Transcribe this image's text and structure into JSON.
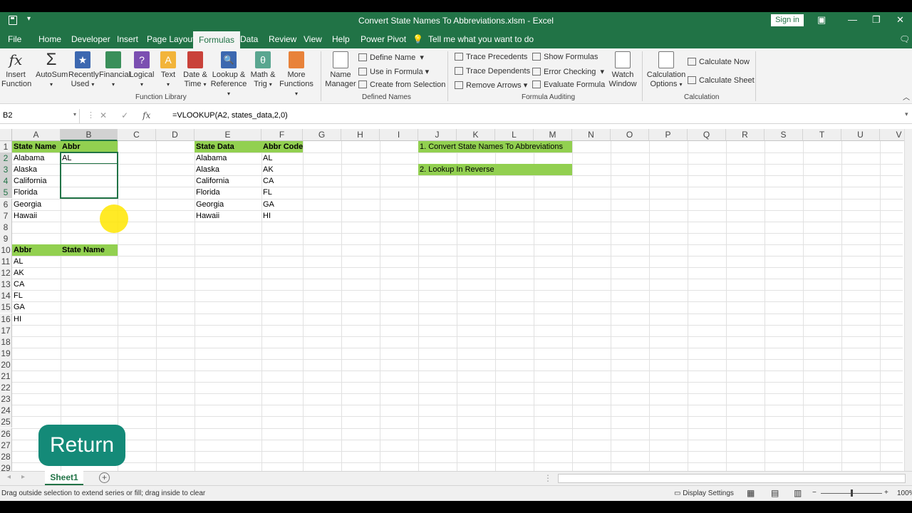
{
  "window": {
    "title": "Convert State Names To Abbreviations.xlsm  -  Excel",
    "signin": "Sign in"
  },
  "menu": {
    "tabs": [
      "File",
      "Home",
      "Developer",
      "Insert",
      "Page Layout",
      "Formulas",
      "Data",
      "Review",
      "View",
      "Help",
      "Power Pivot"
    ],
    "active": "Formulas",
    "tellme": "Tell me what you want to do"
  },
  "ribbon": {
    "insert_function": [
      "Insert",
      "Function"
    ],
    "autosum": "AutoSum",
    "recently_used": [
      "Recently",
      "Used"
    ],
    "financial": "Financial",
    "logical": "Logical",
    "text": "Text",
    "date_time": [
      "Date &",
      "Time"
    ],
    "lookup_ref": [
      "Lookup &",
      "Reference"
    ],
    "math_trig": [
      "Math &",
      "Trig"
    ],
    "more_functions": [
      "More",
      "Functions"
    ],
    "group_function_library": "Function Library",
    "name_manager": [
      "Name",
      "Manager"
    ],
    "define_name": "Define Name",
    "use_in_formula": "Use in Formula",
    "create_from_selection": "Create from Selection",
    "group_defined_names": "Defined Names",
    "trace_precedents": "Trace Precedents",
    "trace_dependents": "Trace Dependents",
    "remove_arrows": "Remove Arrows",
    "show_formulas": "Show Formulas",
    "error_checking": "Error Checking",
    "evaluate_formula": "Evaluate Formula",
    "group_formula_auditing": "Formula Auditing",
    "watch_window": [
      "Watch",
      "Window"
    ],
    "calc_options": [
      "Calculation",
      "Options"
    ],
    "calculate_now": "Calculate Now",
    "calculate_sheet": "Calculate Sheet",
    "group_calculation": "Calculation"
  },
  "formula_bar": {
    "name_box": "B2",
    "fx": "fx",
    "formula": "=VLOOKUP(A2, states_data,2,0)"
  },
  "columns": [
    "A",
    "B",
    "C",
    "D",
    "E",
    "F",
    "G",
    "H",
    "I",
    "J",
    "K",
    "L",
    "M",
    "N",
    "O",
    "P",
    "Q",
    "R",
    "S",
    "T",
    "U",
    "V"
  ],
  "rows": [
    "1",
    "2",
    "3",
    "4",
    "5",
    "6",
    "7",
    "8",
    "9",
    "10",
    "11",
    "12",
    "13",
    "14",
    "15",
    "16",
    "17",
    "18",
    "19",
    "20",
    "21",
    "22",
    "23",
    "24",
    "25",
    "26",
    "27",
    "28",
    "29"
  ],
  "cells": {
    "A1": "State Name",
    "B1": "Abbr",
    "A2": "Alabama",
    "B2": "AL",
    "A3": "Alaska",
    "A4": "California",
    "A5": "Florida",
    "A6": "Georgia",
    "A7": "Hawaii",
    "E1": "State Data",
    "F1": "Abbr Code",
    "E2": "Alabama",
    "F2": "AL",
    "E3": "Alaska",
    "F3": "AK",
    "E4": "California",
    "F4": "CA",
    "E5": "Florida",
    "F5": "FL",
    "E6": "Georgia",
    "F6": "GA",
    "E7": "Hawaii",
    "F7": "HI",
    "J1": "1. Convert State Names To Abbreviations",
    "J3": "2. Lookup In Reverse",
    "A10": "Abbr",
    "B10": "State Name",
    "A11": "AL",
    "A12": "AK",
    "A13": "CA",
    "A14": "FL",
    "A15": "GA",
    "A16": "HI"
  },
  "return_button": "Return",
  "sheet_tab": "Sheet1",
  "status": {
    "message": "Drag outside selection to extend series or fill; drag inside to clear",
    "display_settings": "Display Settings",
    "zoom": "100%"
  }
}
